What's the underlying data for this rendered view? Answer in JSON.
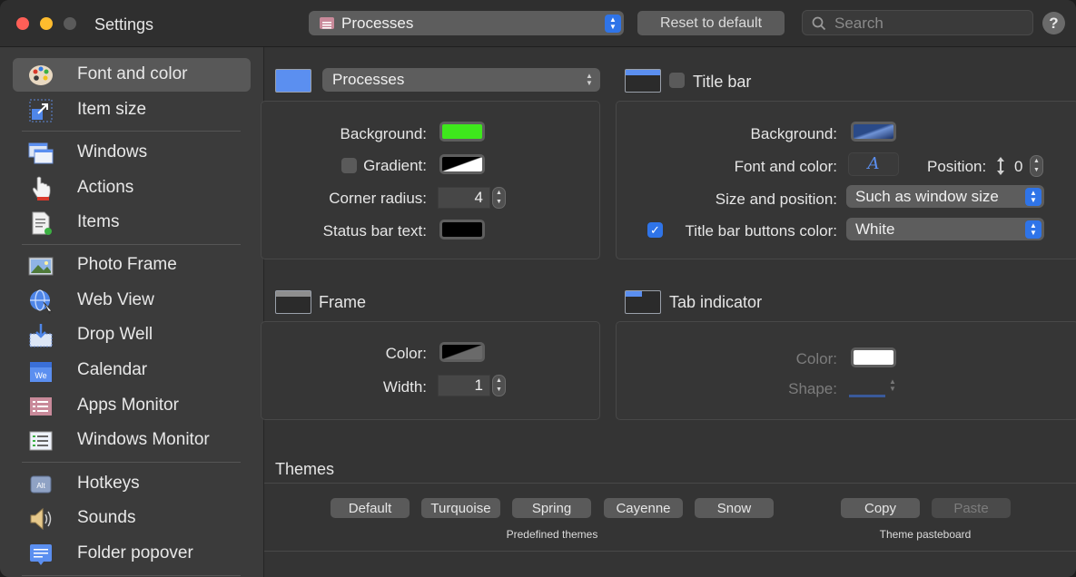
{
  "window": {
    "title": "Settings"
  },
  "toolbar": {
    "profile_select": "Processes",
    "reset_button": "Reset to default",
    "search_placeholder": "Search",
    "help_label": "?"
  },
  "sidebar": {
    "items": [
      {
        "label": "Font and color",
        "icon": "palette-icon",
        "selected": true
      },
      {
        "label": "Item size",
        "icon": "resize-icon"
      },
      {
        "label": "Windows",
        "icon": "windows-icon"
      },
      {
        "label": "Actions",
        "icon": "hand-pointer-icon"
      },
      {
        "label": "Items",
        "icon": "document-icon"
      },
      {
        "label": "Photo Frame",
        "icon": "photo-icon"
      },
      {
        "label": "Web View",
        "icon": "globe-icon"
      },
      {
        "label": "Drop Well",
        "icon": "drop-well-icon"
      },
      {
        "label": "Calendar",
        "icon": "calendar-icon"
      },
      {
        "label": "Apps Monitor",
        "icon": "apps-monitor-icon"
      },
      {
        "label": "Windows Monitor",
        "icon": "windows-monitor-icon"
      },
      {
        "label": "Hotkeys",
        "icon": "keyboard-icon"
      },
      {
        "label": "Sounds",
        "icon": "speaker-icon"
      },
      {
        "label": "Folder popover",
        "icon": "folder-popover-icon"
      }
    ]
  },
  "window_section": {
    "select": "Processes",
    "background_label": "Background:",
    "background_color": "#3ee81c",
    "gradient_label": "Gradient:",
    "corner_radius_label": "Corner radius:",
    "corner_radius_value": "4",
    "status_bar_text_label": "Status bar text:",
    "status_bar_text_color": "#000000"
  },
  "titlebar_section": {
    "title": "Title bar",
    "background_label": "Background:",
    "font_color_label": "Font and color:",
    "font_glyph": "A",
    "position_label": "Position:",
    "position_value": "0",
    "size_position_label": "Size and position:",
    "size_position_value": "Such as window size",
    "buttons_color_label": "Title bar buttons color:",
    "buttons_color_value": "White"
  },
  "frame_section": {
    "title": "Frame",
    "color_label": "Color:",
    "width_label": "Width:",
    "width_value": "1"
  },
  "tab_section": {
    "title": "Tab indicator",
    "color_label": "Color:",
    "tab_color": "#ffffff",
    "shape_label": "Shape:"
  },
  "themes": {
    "title": "Themes",
    "predefined": [
      "Default",
      "Turquoise",
      "Spring",
      "Cayenne",
      "Snow"
    ],
    "predefined_caption": "Predefined themes",
    "copy": "Copy",
    "paste": "Paste",
    "pasteboard_caption": "Theme pasteboard"
  }
}
